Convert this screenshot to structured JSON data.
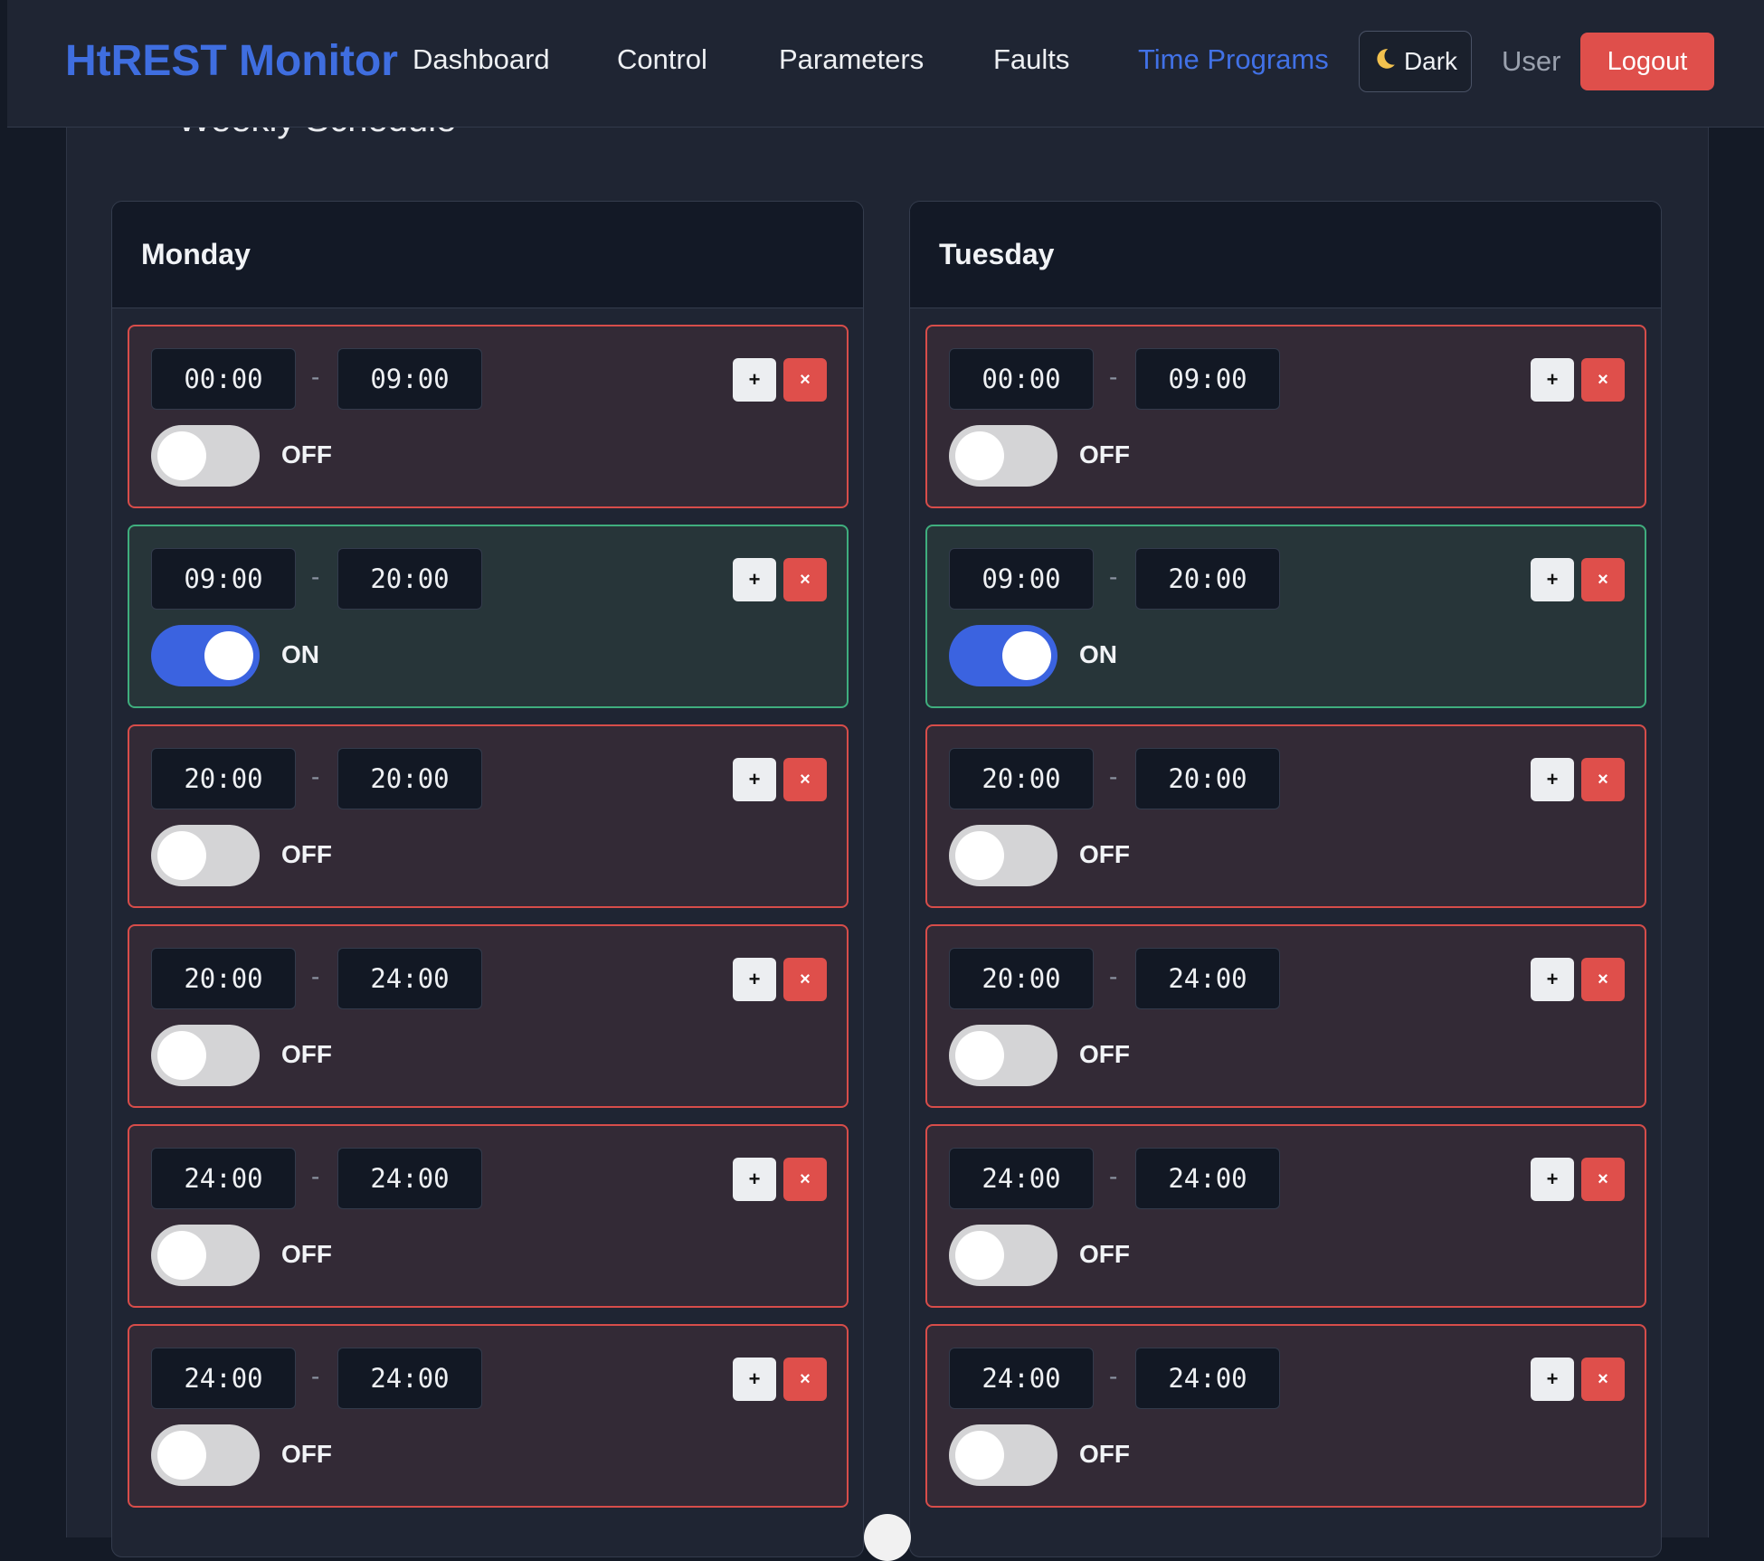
{
  "navbar": {
    "brand": "HtREST Monitor",
    "links": [
      "Dashboard",
      "Control",
      "Parameters",
      "Faults",
      "Time Programs"
    ],
    "active": "Time Programs",
    "theme_icon": "moon-icon",
    "theme_label": "Dark",
    "user": "User",
    "logout": "Logout"
  },
  "page": {
    "title": "Weekly Schedule"
  },
  "colors": {
    "accent": "#3f6ee0",
    "danger": "#df4f4b",
    "on_border": "#3fae7e",
    "off_border": "#d74d4a"
  },
  "days": [
    {
      "name": "Monday",
      "slots": [
        {
          "start": "00:00",
          "end": "09:00",
          "state": "OFF"
        },
        {
          "start": "09:00",
          "end": "20:00",
          "state": "ON"
        },
        {
          "start": "20:00",
          "end": "20:00",
          "state": "OFF"
        },
        {
          "start": "20:00",
          "end": "24:00",
          "state": "OFF"
        },
        {
          "start": "24:00",
          "end": "24:00",
          "state": "OFF"
        },
        {
          "start": "24:00",
          "end": "24:00",
          "state": "OFF"
        }
      ]
    },
    {
      "name": "Tuesday",
      "slots": [
        {
          "start": "00:00",
          "end": "09:00",
          "state": "OFF"
        },
        {
          "start": "09:00",
          "end": "20:00",
          "state": "ON"
        },
        {
          "start": "20:00",
          "end": "20:00",
          "state": "OFF"
        },
        {
          "start": "20:00",
          "end": "24:00",
          "state": "OFF"
        },
        {
          "start": "24:00",
          "end": "24:00",
          "state": "OFF"
        },
        {
          "start": "24:00",
          "end": "24:00",
          "state": "OFF"
        }
      ]
    }
  ],
  "slot_controls": {
    "add": "+",
    "remove": "×",
    "separator": "-"
  }
}
